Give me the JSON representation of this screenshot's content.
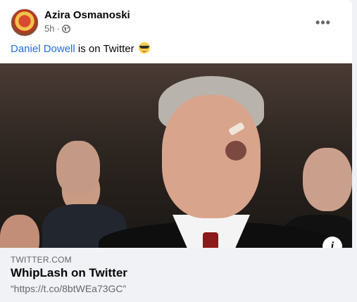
{
  "post": {
    "author": "Azira Osmanoski",
    "time": "5h",
    "separator": "·",
    "audience_icon": "globe-icon",
    "more_icon": "ellipsis-icon",
    "more_label": "•••",
    "text": {
      "mention": "Daniel Dowell",
      "rest": " is on Twitter ",
      "emoji": "smiling-face-with-sunglasses"
    }
  },
  "link_preview": {
    "domain": "TWITTER.COM",
    "title": "WhipLash on Twitter",
    "description": "“https://t.co/8btWEa73GC”",
    "info_label": "i"
  },
  "colors": {
    "link": "#216fdb",
    "text": "#050505",
    "secondary": "#65676b",
    "preview_bg": "#f0f2f5"
  }
}
